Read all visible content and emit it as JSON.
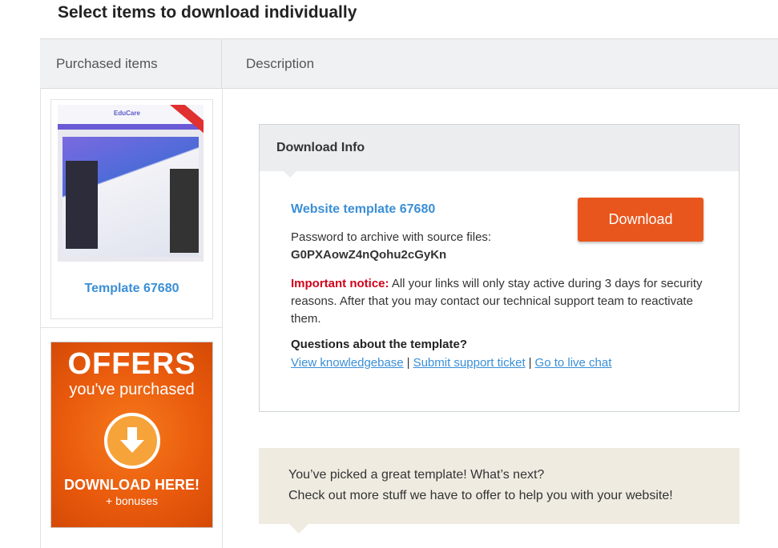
{
  "page": {
    "title": "Select items to download individually"
  },
  "tabs": [
    {
      "label": "Purchased items"
    },
    {
      "label": "Description"
    }
  ],
  "item": {
    "name": "Template 67680",
    "thumb_logo": "EduCare"
  },
  "offers": {
    "line1": "OFFERS",
    "line2": "you've purchased",
    "line3": "DOWNLOAD HERE!",
    "line4": "+ bonuses",
    "icon": "download-arrow-icon",
    "color": "#e8590c"
  },
  "download_info": {
    "header": "Download Info",
    "template_title": "Website template 67680",
    "download_label": "Download",
    "password_label": "Password to archive with source files:",
    "password_value": "G0PXAowZ4nQohu2cGyKn",
    "notice_label": "Important notice:",
    "notice_text": " All your links will only stay active during 3 days for security reasons. After that you may contact our technical support team to reactivate them.",
    "questions_title": "Questions about the template?",
    "links": [
      {
        "label": "View knowledgebase"
      },
      {
        "label": "Submit support ticket"
      },
      {
        "label": "Go to live chat"
      }
    ],
    "link_separator": "|",
    "accent_color": "#e8561d",
    "link_color": "#3a8fd6",
    "notice_color": "#d0021b"
  },
  "next": {
    "line1": "You’ve picked a great template! What’s next?",
    "line2": "Check out more stuff we have to offer to help you with your website!"
  }
}
